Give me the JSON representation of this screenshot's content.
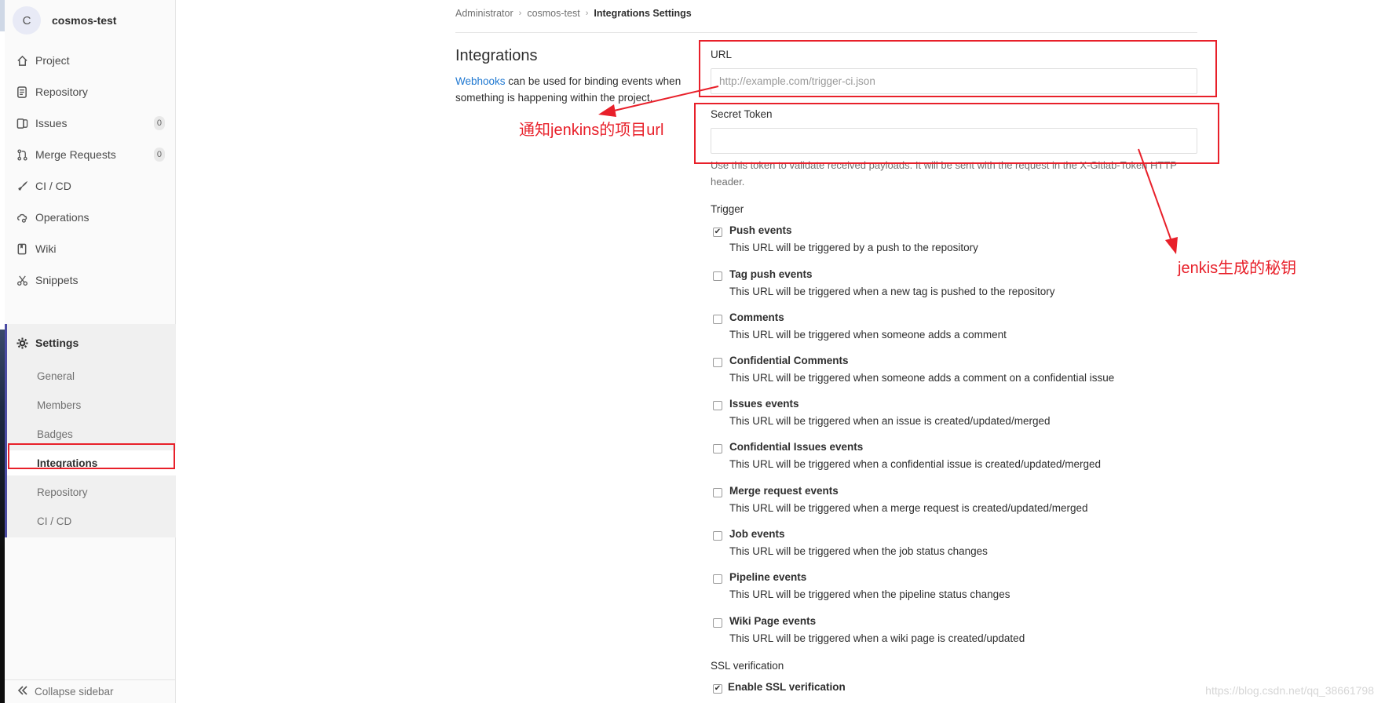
{
  "project": {
    "avatar_letter": "C",
    "name": "cosmos-test"
  },
  "sidebar": {
    "items": [
      {
        "label": "Project",
        "icon": "home-icon"
      },
      {
        "label": "Repository",
        "icon": "document-icon"
      },
      {
        "label": "Issues",
        "icon": "issues-icon",
        "count": "0"
      },
      {
        "label": "Merge Requests",
        "icon": "merge-request-icon",
        "count": "0"
      },
      {
        "label": "CI / CD",
        "icon": "rocket-icon"
      },
      {
        "label": "Operations",
        "icon": "cloud-gear-icon"
      },
      {
        "label": "Wiki",
        "icon": "book-icon"
      },
      {
        "label": "Snippets",
        "icon": "scissors-icon"
      }
    ],
    "settings": {
      "label": "Settings",
      "icon": "gear-icon",
      "sub_items": [
        "General",
        "Members",
        "Badges",
        "Integrations",
        "Repository",
        "CI / CD"
      ],
      "active": "Integrations"
    },
    "collapse_label": "Collapse sidebar"
  },
  "breadcrumb": [
    "Administrator",
    "cosmos-test",
    "Integrations Settings"
  ],
  "section": {
    "title": "Integrations",
    "desc_link": "Webhooks",
    "desc_rest": " can be used for binding events when something is happening within the project."
  },
  "form": {
    "url_label": "URL",
    "url_placeholder": "http://example.com/trigger-ci.json",
    "url_value": "",
    "token_label": "Secret Token",
    "token_value": "",
    "token_help": "Use this token to validate received payloads. It will be sent with the request in the X-Gitlab-Token HTTP header.",
    "trigger_label": "Trigger",
    "triggers": [
      {
        "name": "Push events",
        "desc": "This URL will be triggered by a push to the repository",
        "checked": true
      },
      {
        "name": "Tag push events",
        "desc": "This URL will be triggered when a new tag is pushed to the repository",
        "checked": false
      },
      {
        "name": "Comments",
        "desc": "This URL will be triggered when someone adds a comment",
        "checked": false
      },
      {
        "name": "Confidential Comments",
        "desc": "This URL will be triggered when someone adds a comment on a confidential issue",
        "checked": false
      },
      {
        "name": "Issues events",
        "desc": "This URL will be triggered when an issue is created/updated/merged",
        "checked": false
      },
      {
        "name": "Confidential Issues events",
        "desc": "This URL will be triggered when a confidential issue is created/updated/merged",
        "checked": false
      },
      {
        "name": "Merge request events",
        "desc": "This URL will be triggered when a merge request is created/updated/merged",
        "checked": false
      },
      {
        "name": "Job events",
        "desc": "This URL will be triggered when the job status changes",
        "checked": false
      },
      {
        "name": "Pipeline events",
        "desc": "This URL will be triggered when the pipeline status changes",
        "checked": false
      },
      {
        "name": "Wiki Page events",
        "desc": "This URL will be triggered when a wiki page is created/updated",
        "checked": false
      }
    ],
    "ssl_label": "SSL verification",
    "ssl_option": "Enable SSL verification",
    "ssl_checked": true
  },
  "annotations": {
    "url_note": "通知jenkins的项目url",
    "token_note": "jenkis生成的秘钥",
    "color": "#e8202a"
  },
  "watermark": "https://blog.csdn.net/qq_38661798"
}
